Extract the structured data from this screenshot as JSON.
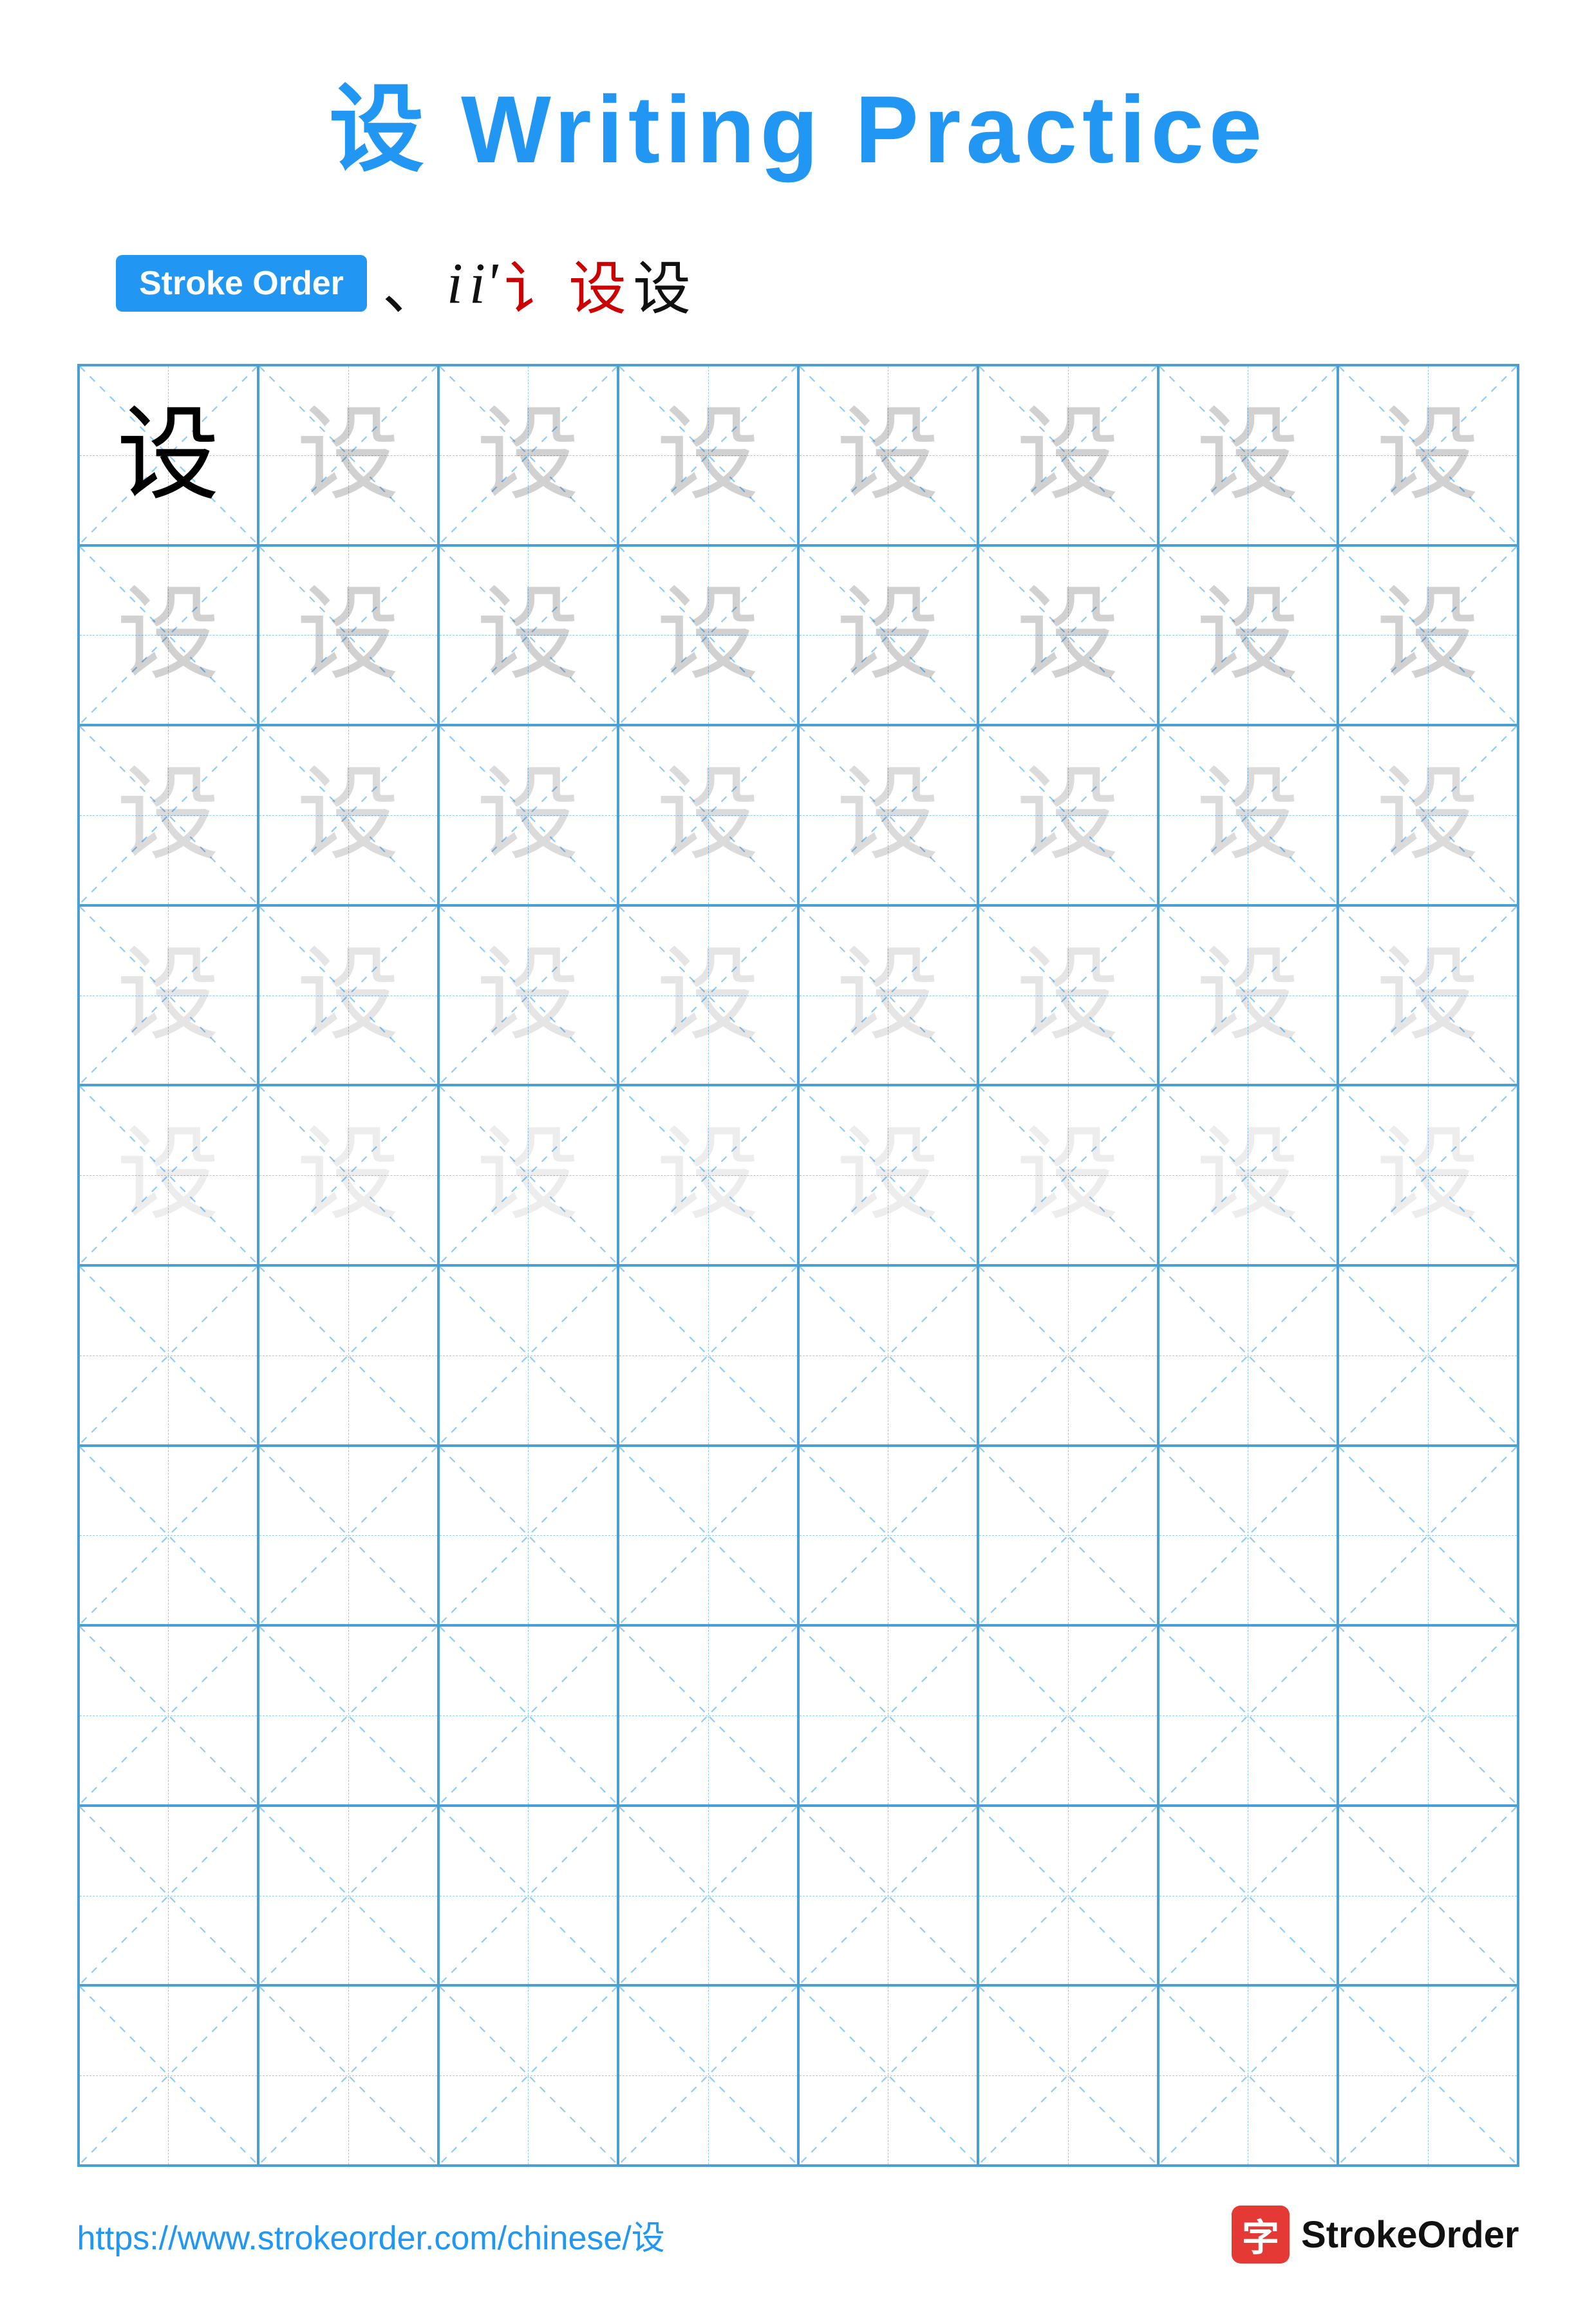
{
  "title": "设 Writing Practice",
  "stroke_order_label": "Stroke Order",
  "stroke_sequence": [
    "` ",
    "i",
    "i'",
    "i\"",
    "设",
    "设"
  ],
  "character": "设",
  "grid": {
    "rows": 10,
    "cols": 8,
    "practice_rows": 5,
    "empty_rows": 5
  },
  "footer": {
    "url": "https://www.strokeorder.com/chinese/设",
    "logo_char": "字",
    "logo_text": "StrokeOrder"
  },
  "char_opacities": [
    1,
    0.18,
    0.14,
    0.1,
    0.07
  ]
}
